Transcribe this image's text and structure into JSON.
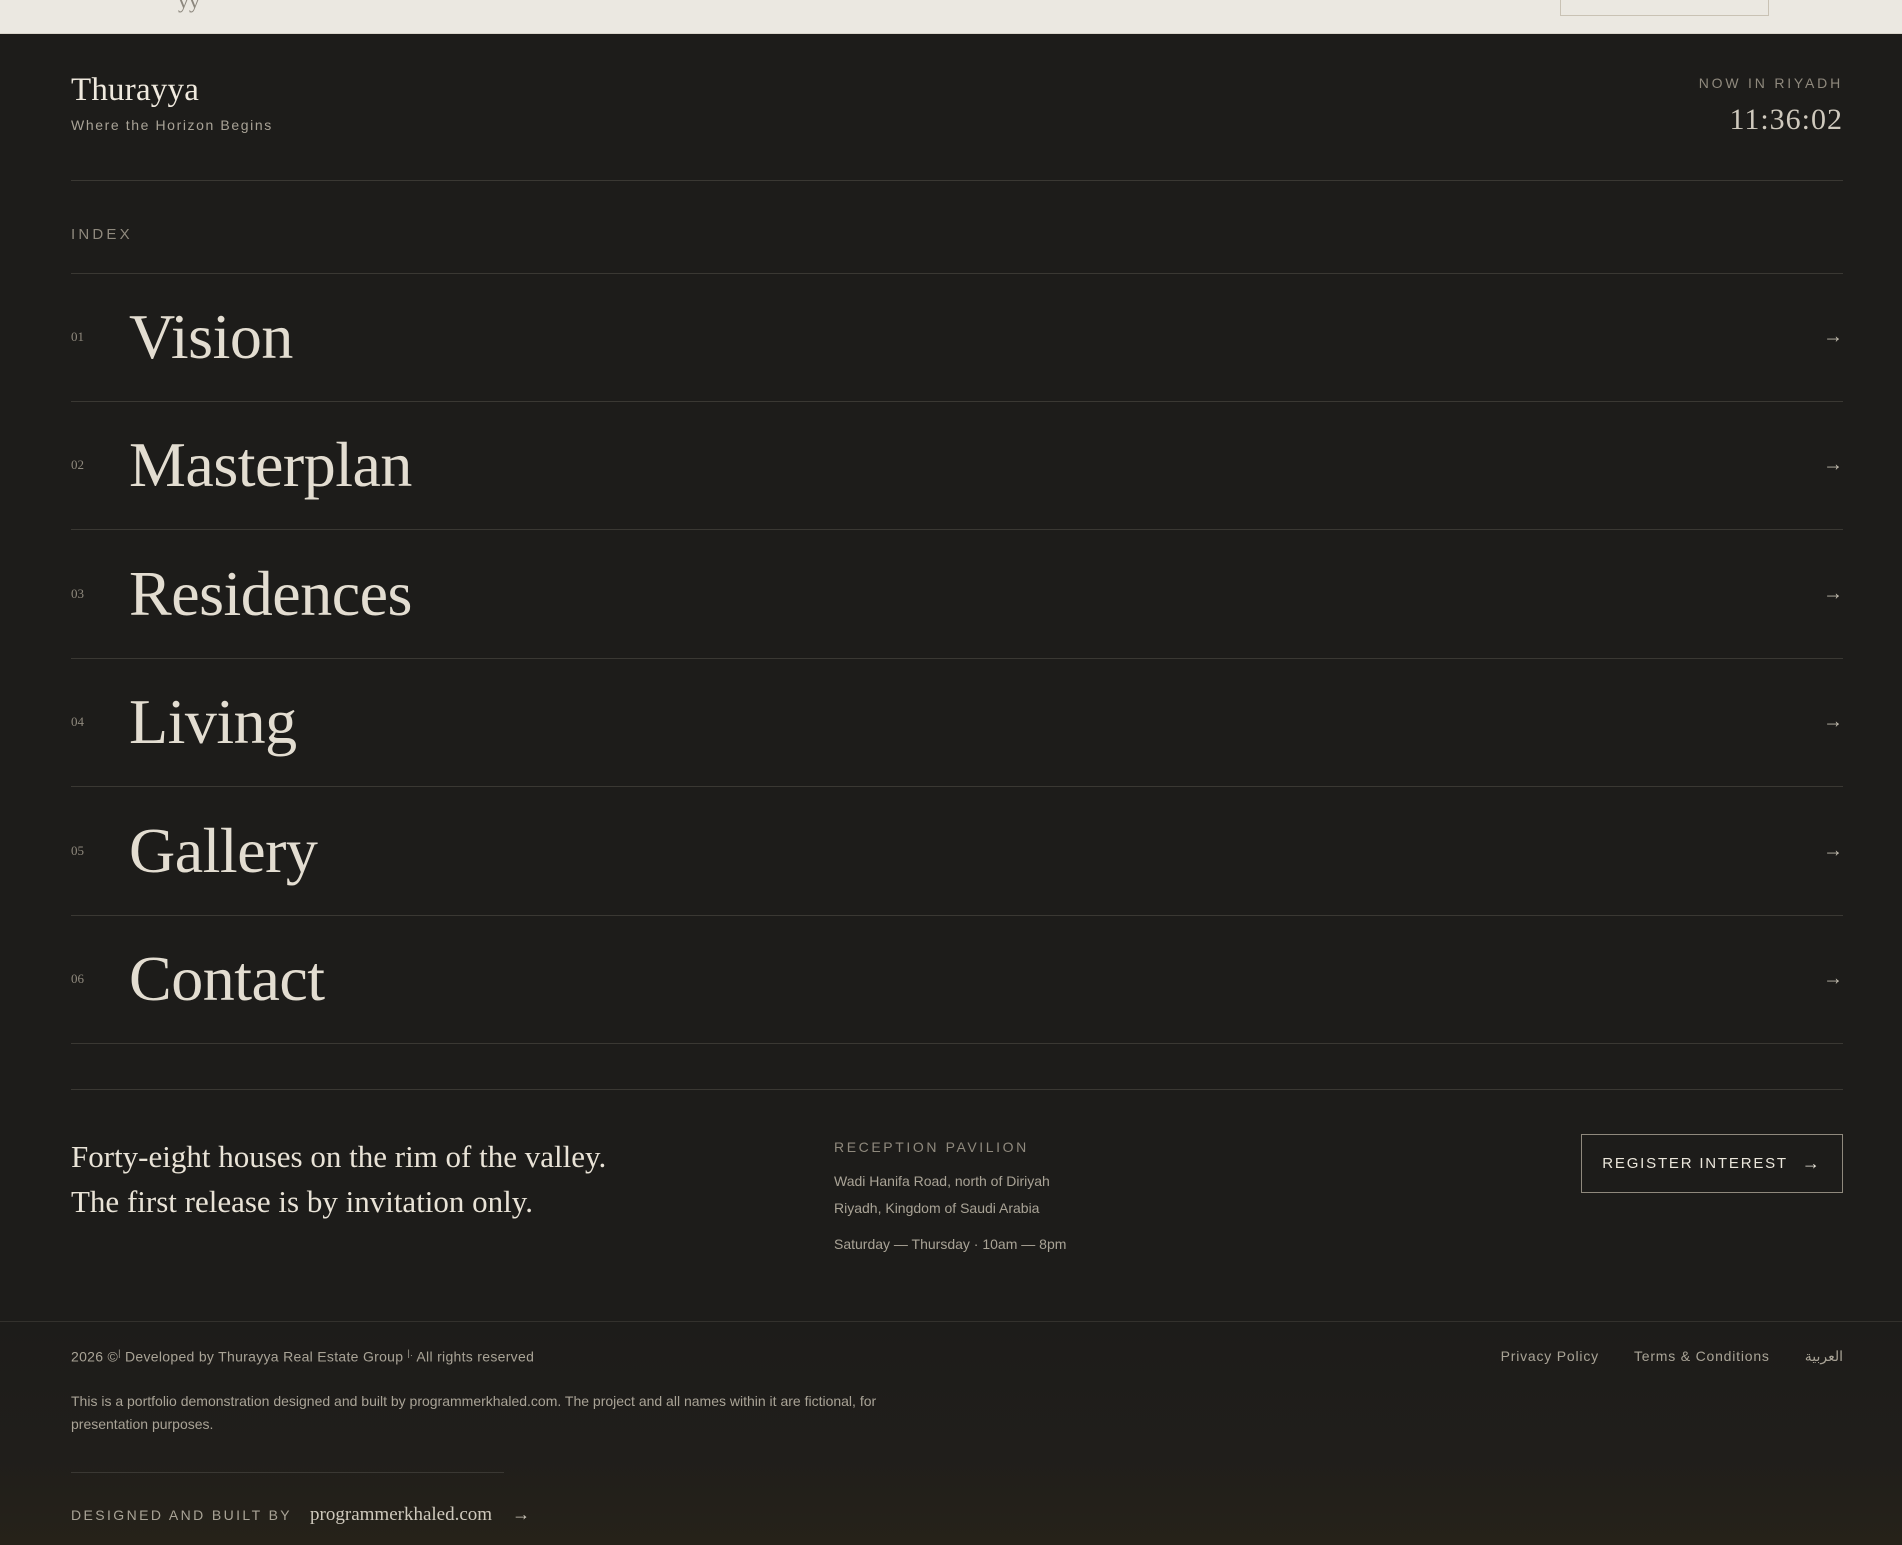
{
  "top_strip": {
    "partial_text": "yy"
  },
  "brand": {
    "name": "Thurayya",
    "tagline": "Where the Horizon Begins"
  },
  "clock": {
    "label": "NOW IN RIYADH",
    "time": "11:36:02"
  },
  "index": {
    "label": "INDEX",
    "arrow": "→",
    "items": [
      {
        "num": "01",
        "label": "Vision"
      },
      {
        "num": "02",
        "label": "Masterplan"
      },
      {
        "num": "03",
        "label": "Residences"
      },
      {
        "num": "04",
        "label": "Living"
      },
      {
        "num": "05",
        "label": "Gallery"
      },
      {
        "num": "06",
        "label": "Contact"
      }
    ]
  },
  "pitch": {
    "line1": "Forty-eight houses on the rim of the valley.",
    "line2": "The first release is by invitation only."
  },
  "pavilion": {
    "title": "RECEPTION PAVILION",
    "address1": "Wadi Hanifa Road, north of Diriyah",
    "address2": "Riyadh, Kingdom of Saudi Arabia",
    "hours": "Saturday — Thursday · 10am — 8pm"
  },
  "register": {
    "label": "REGISTER INTEREST",
    "arrow": "→"
  },
  "footer": {
    "copyright_prefix": "2026 ©",
    "copyright_mid": " Developed by Thurayya Real Estate Group ",
    "copyright_sup1": "|",
    "copyright_sup2": "|.",
    "copyright_suffix": " All rights reserved",
    "links": {
      "privacy": "Privacy Policy",
      "terms": "Terms & Conditions",
      "language": "العربية"
    },
    "disclaimer": "This is a portfolio demonstration designed and built by programmerkhaled.com. The project and all names within it are fictional, for presentation purposes.",
    "credit_label": "DESIGNED AND BUILT BY",
    "credit_link": "programmerkhaled.com",
    "credit_arrow": "→"
  },
  "colors": {
    "background": "#1d1c1a",
    "text": "#e9e4da",
    "muted": "#8f897d",
    "rule": "#3a3833",
    "top_strip": "#ebe8e1"
  }
}
